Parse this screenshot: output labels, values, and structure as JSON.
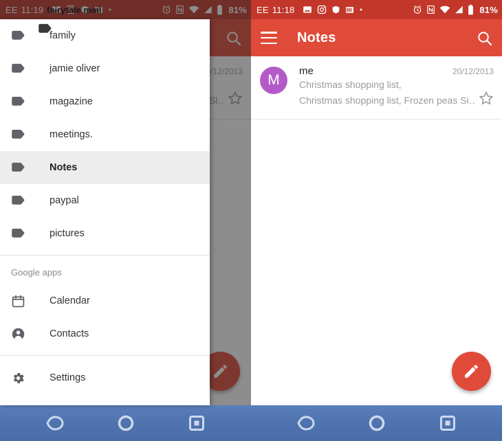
{
  "status_bar": {
    "carrier": "EE",
    "time_left_panel": "11:19",
    "time_right_panel": "11:18",
    "battery_text": "81%",
    "notification_icons": [
      "photo-icon",
      "instagram-icon",
      "shield-icon",
      "app-icon",
      "dot-icon"
    ],
    "system_icons": [
      "alarm-icon",
      "nfc-icon",
      "wifi-icon",
      "signal-icon",
      "battery-icon"
    ],
    "background_color": "#C2372A"
  },
  "app_bar": {
    "title": "Notes",
    "menu_label": "menu",
    "search_label": "search",
    "background_color": "#E04A38"
  },
  "mail_list": {
    "items": [
      {
        "avatar_letter": "M",
        "avatar_color": "#B45AC8",
        "sender": "me",
        "date": "20/12/2013",
        "subject": "Christmas shopping list,",
        "snippet": "Christmas shopping list, Frozen peas Si…",
        "starred": false
      }
    ]
  },
  "fab": {
    "label": "compose",
    "color": "#E04A38"
  },
  "drawer": {
    "overlay_title": "fairytale mail",
    "labels": [
      {
        "label": "family",
        "icon": "label-icon",
        "selected": false
      },
      {
        "label": "jamie oliver",
        "icon": "label-icon",
        "selected": false
      },
      {
        "label": "magazine",
        "icon": "label-icon",
        "selected": false
      },
      {
        "label": "meetings.",
        "icon": "label-icon",
        "selected": false
      },
      {
        "label": "Notes",
        "icon": "label-icon",
        "selected": true
      },
      {
        "label": "paypal",
        "icon": "label-icon",
        "selected": false
      },
      {
        "label": "pictures",
        "icon": "label-icon",
        "selected": false
      }
    ],
    "section_header": "Google apps",
    "apps": [
      {
        "label": "Calendar",
        "icon": "calendar-icon"
      },
      {
        "label": "Contacts",
        "icon": "person-icon"
      }
    ],
    "settings": {
      "label": "Settings",
      "icon": "gear-icon"
    }
  },
  "nav_bar": {
    "back_label": "Back",
    "home_label": "Home",
    "recents_label": "Recents",
    "background_color": "#4f74b0"
  }
}
